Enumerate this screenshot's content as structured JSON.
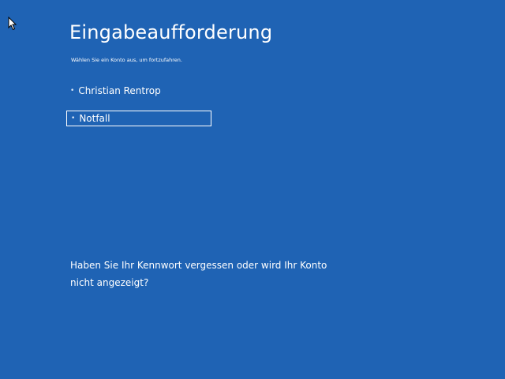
{
  "screen": {
    "title": "Eingabeaufforderung",
    "subtitle": "Wählen Sie ein Konto aus, um fortzufahren."
  },
  "accounts": [
    {
      "name": "Christian Rentrop",
      "selected": false
    },
    {
      "name": "Notfall",
      "selected": true
    }
  ],
  "forgot_link": "Haben Sie Ihr Kennwort vergessen oder wird Ihr Konto nicht angezeigt?",
  "colors": {
    "background": "#1f63b4",
    "text": "#ffffff"
  },
  "icons": {
    "cursor": "mouse-pointer-icon",
    "bullet": "bullet-dot-icon"
  }
}
